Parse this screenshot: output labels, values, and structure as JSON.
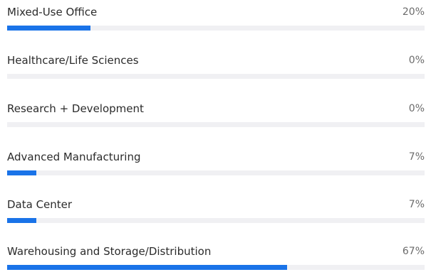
{
  "accent_color": "#1a73e8",
  "track_color": "#f0f0f3",
  "items": [
    {
      "label": "Mixed-Use Office",
      "percent_text": "20%",
      "value": 20
    },
    {
      "label": "Healthcare/Life Sciences",
      "percent_text": "0%",
      "value": 0
    },
    {
      "label": "Research + Development",
      "percent_text": "0%",
      "value": 0
    },
    {
      "label": "Advanced Manufacturing",
      "percent_text": "7%",
      "value": 7
    },
    {
      "label": "Data Center",
      "percent_text": "7%",
      "value": 7
    },
    {
      "label": "Warehousing and Storage/Distribution",
      "percent_text": "67%",
      "value": 67
    }
  ]
}
